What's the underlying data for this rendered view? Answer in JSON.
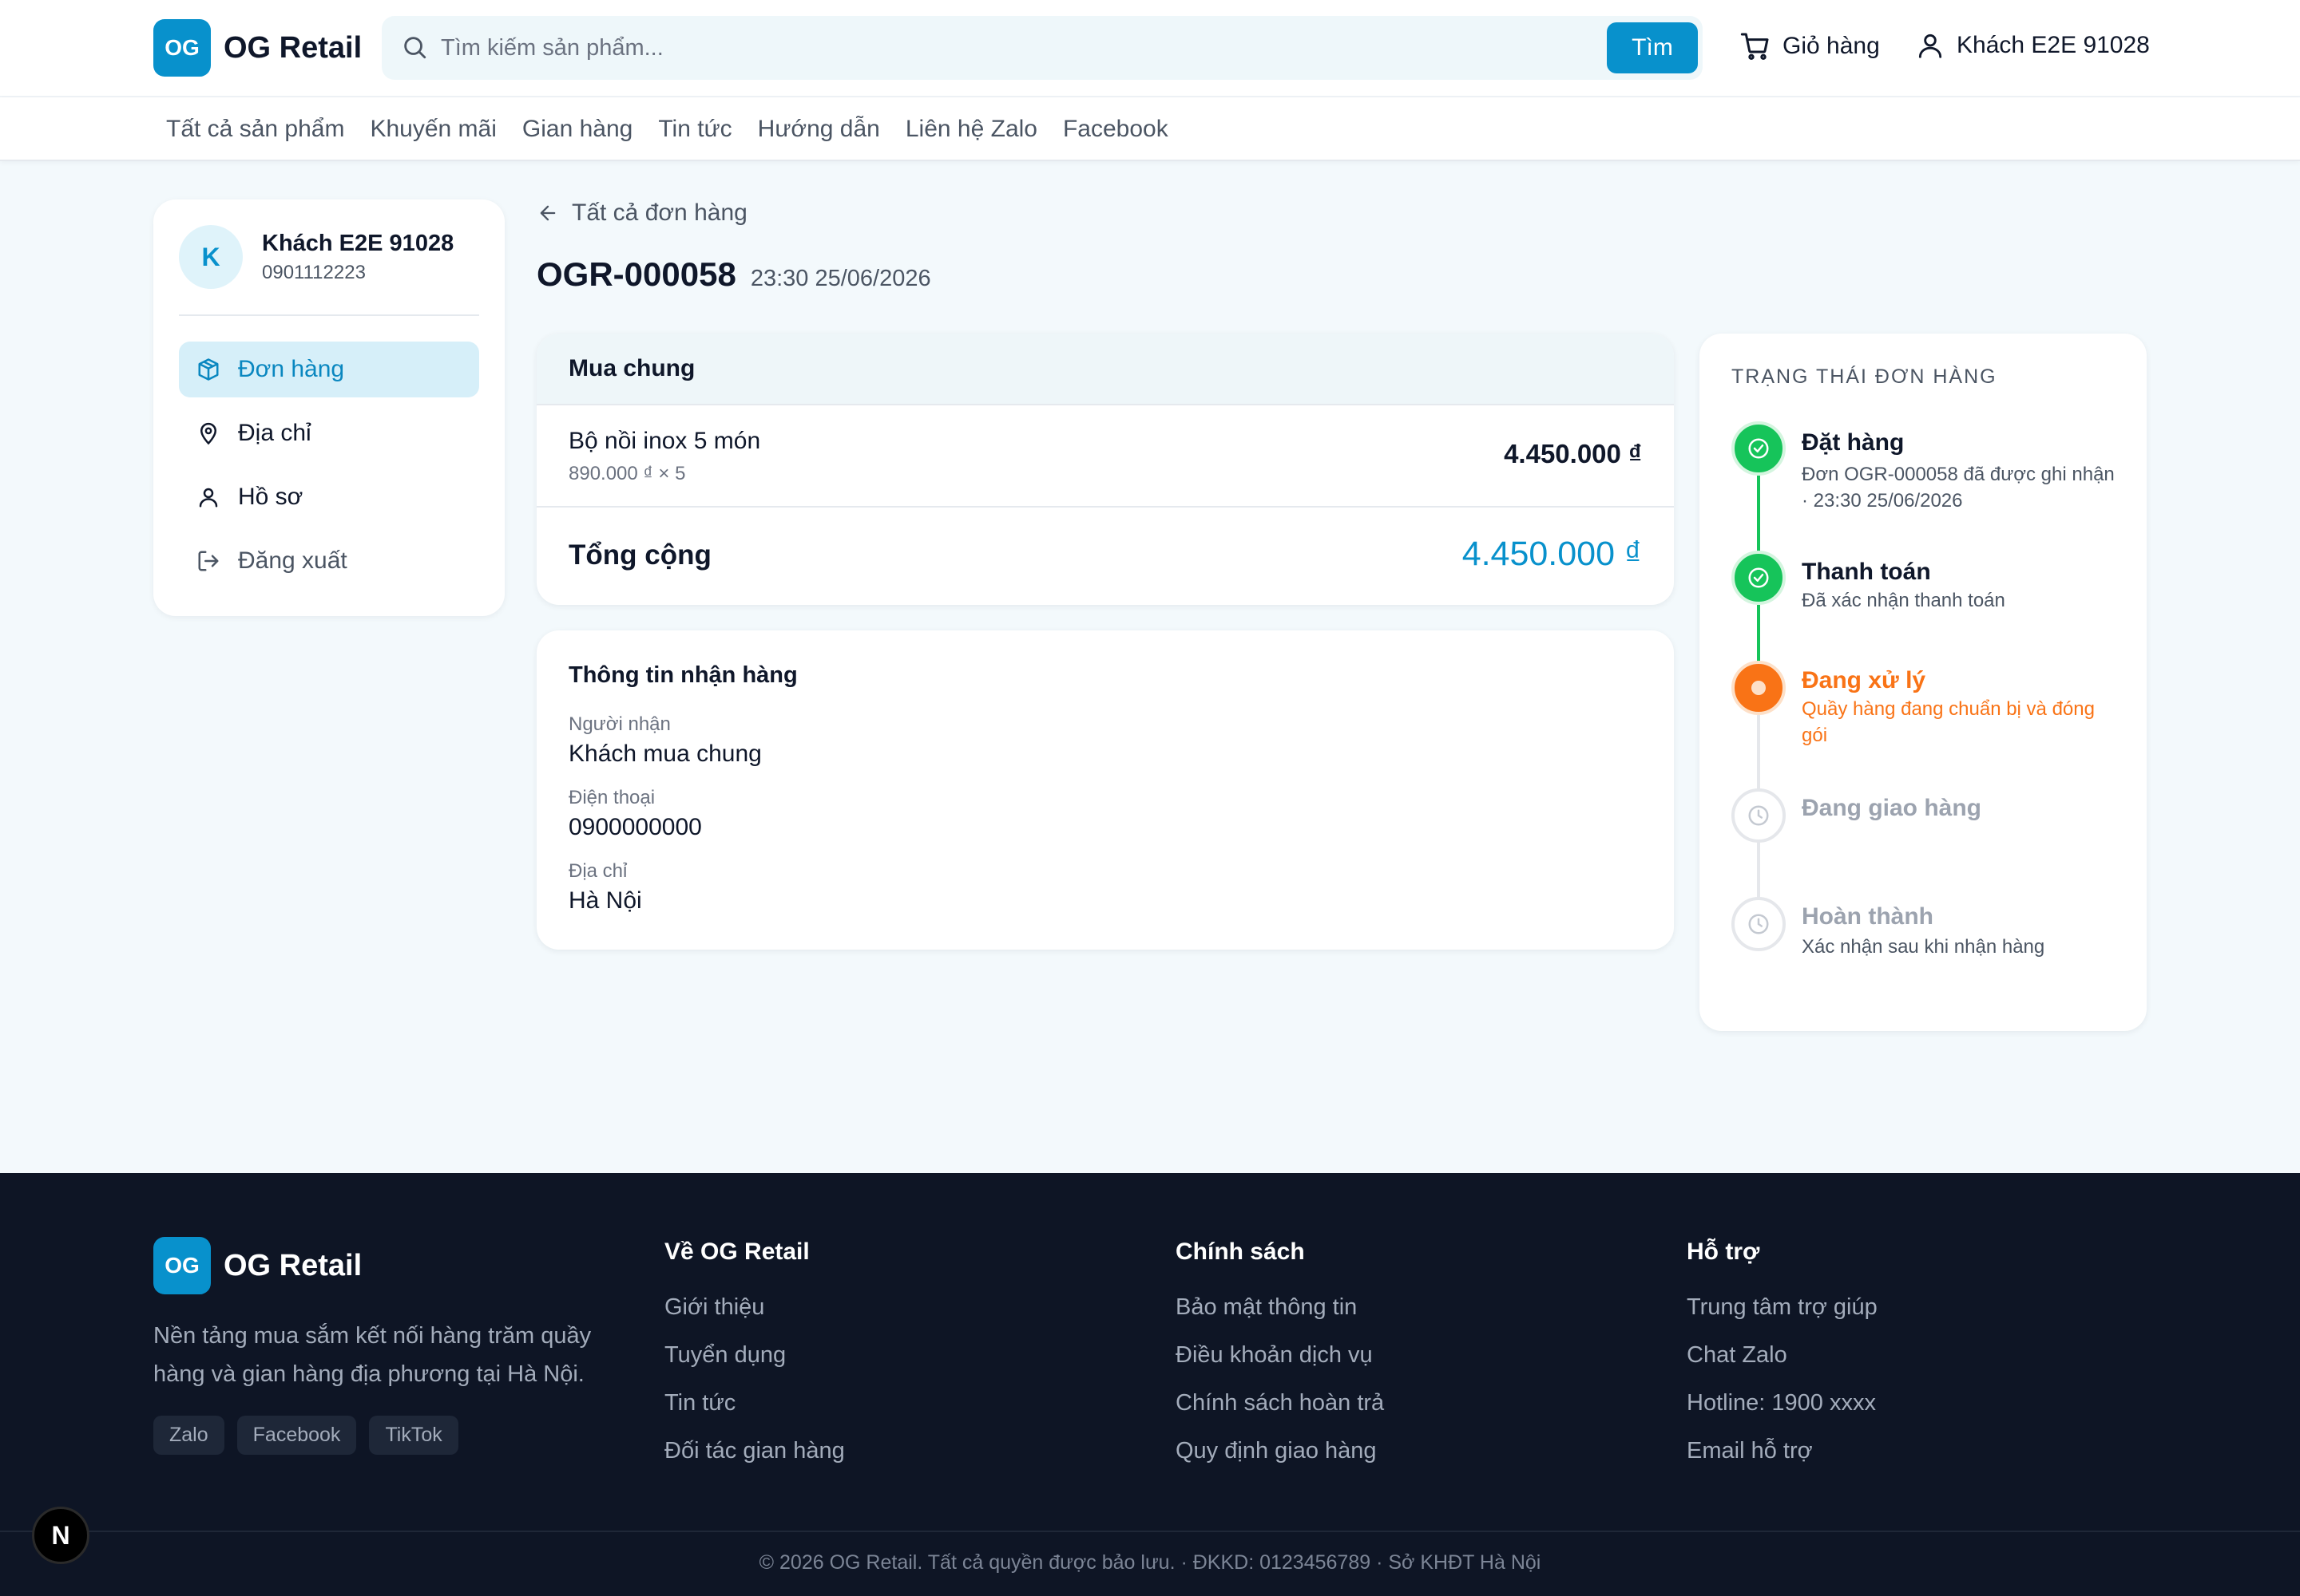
{
  "brand": {
    "logo_mark": "OG",
    "name": "OG Retail",
    "accent": "#0891cc"
  },
  "header": {
    "search_placeholder": "Tìm kiếm sản phẩm...",
    "search_value": "",
    "search_button": "Tìm",
    "cart_label": "Giỏ hàng",
    "user_label": "Khách E2E 91028"
  },
  "nav": {
    "items": [
      {
        "label": "Tất cả sản phẩm"
      },
      {
        "label": "Khuyến mãi"
      },
      {
        "label": "Gian hàng"
      },
      {
        "label": "Tin tức"
      },
      {
        "label": "Hướng dẫn"
      },
      {
        "label": "Liên hệ Zalo"
      },
      {
        "label": "Facebook"
      }
    ]
  },
  "sidebar": {
    "avatar_letter": "K",
    "name": "Khách E2E 91028",
    "phone": "0901112223",
    "items": [
      {
        "label": "Đơn hàng",
        "icon": "box-icon",
        "active": true
      },
      {
        "label": "Địa chỉ",
        "icon": "map-pin-icon"
      },
      {
        "label": "Hồ sơ",
        "icon": "user-icon"
      },
      {
        "label": "Đăng xuất",
        "icon": "logout-icon"
      }
    ]
  },
  "order": {
    "back_label": "Tất cả đơn hàng",
    "id": "OGR-000058",
    "time": "23:30 25/06/2026",
    "group_title": "Mua chung",
    "items": [
      {
        "name": "Bộ nồi inox 5 món",
        "unit": "890.000 ₫ × 5",
        "price": "4.450.000 ₫"
      }
    ],
    "total_label": "Tổng cộng",
    "total_value": "4.450.000 ₫"
  },
  "shipping": {
    "title": "Thông tin nhận hàng",
    "fields": [
      {
        "label": "Người nhận",
        "value": "Khách mua chung"
      },
      {
        "label": "Điện thoại",
        "value": "0900000000"
      },
      {
        "label": "Địa chỉ",
        "value": "Hà Nội"
      }
    ]
  },
  "status": {
    "title": "TRẠNG THÁI ĐƠN HÀNG",
    "colors": {
      "done": "#16c45a",
      "current": "#f97316",
      "pending": "#9ca3af"
    },
    "steps": [
      {
        "title": "Đặt hàng",
        "desc": "Đơn OGR-000058 đã được ghi nhận · 23:30 25/06/2026",
        "state": "done"
      },
      {
        "title": "Thanh toán",
        "desc": "Đã xác nhận thanh toán",
        "state": "done"
      },
      {
        "title": "Đang xử lý",
        "desc": "Quầy hàng đang chuẩn bị và đóng gói",
        "state": "current"
      },
      {
        "title": "Đang giao hàng",
        "desc": "",
        "state": "pending"
      },
      {
        "title": "Hoàn thành",
        "desc": "Xác nhận sau khi nhận hàng",
        "state": "pending"
      }
    ]
  },
  "footer": {
    "desc": "Nền tảng mua sắm kết nối hàng trăm quầy hàng và gian hàng địa phương tại Hà Nội.",
    "tags": [
      "Zalo",
      "Facebook",
      "TikTok"
    ],
    "columns": [
      {
        "title": "Về OG Retail",
        "links": [
          "Giới thiệu",
          "Tuyển dụng",
          "Tin tức",
          "Đối tác gian hàng"
        ]
      },
      {
        "title": "Chính sách",
        "links": [
          "Bảo mật thông tin",
          "Điều khoản dịch vụ",
          "Chính sách hoàn trả",
          "Quy định giao hàng"
        ]
      },
      {
        "title": "Hỗ trợ",
        "links": [
          "Trung tâm trợ giúp",
          "Chat Zalo",
          "Hotline: 1900 xxxx",
          "Email hỗ trợ"
        ]
      }
    ],
    "copyright": "© 2026 OG Retail. Tất cả quyền được bảo lưu. · ĐKKD: 0123456789 · Sở KHĐT Hà Nội"
  },
  "dev_badge": "N"
}
